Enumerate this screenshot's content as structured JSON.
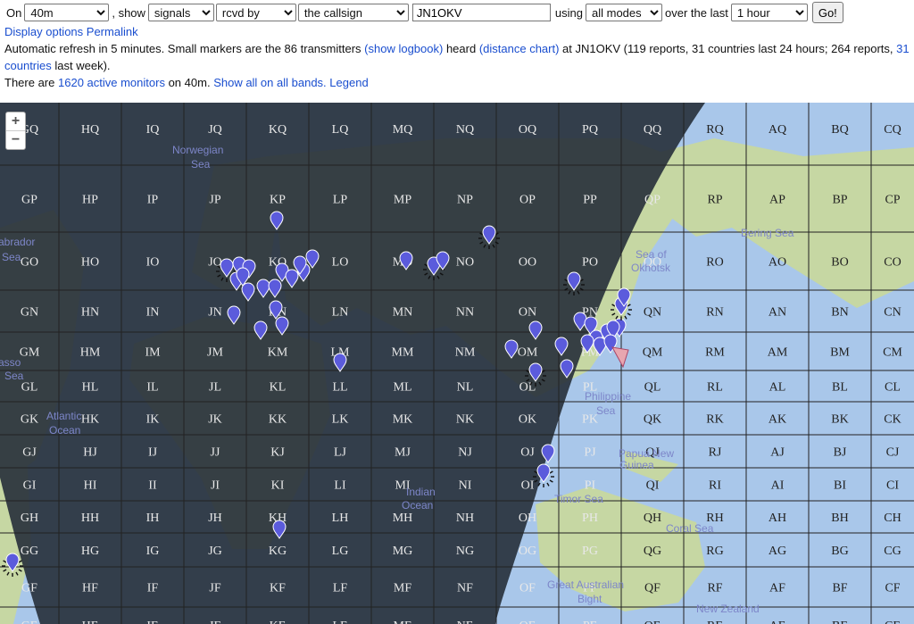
{
  "controls": {
    "on_label": "On",
    "band": "40m",
    "show_label": ", show",
    "show": "signals",
    "direction": "rcvd by",
    "target": "the callsign",
    "callsign": "JN1OKV",
    "using_label": "using",
    "mode": "all modes",
    "over_label": "over the last",
    "period": "1 hour",
    "go_label": "Go!"
  },
  "links": {
    "display_options": "Display options",
    "permalink": "Permalink",
    "show_logbook": "(show logbook)",
    "distance_chart": "(distance chart)",
    "countries_week_num": "31",
    "countries_word": "countries",
    "active_monitors": "1620 active monitors",
    "show_all": "Show all on all bands.",
    "legend": "Legend"
  },
  "info": {
    "line2a": "Automatic refresh in 5 minutes. Small markers are the 86 transmitters",
    "heard": "heard",
    "at_text": "at JN1OKV (119 reports, 31 countries last 24 hours; 264 reports,",
    "last_week": "last week).",
    "there_are": "There are",
    "on_band": "on 40m."
  },
  "map": {
    "zoom_in": "+",
    "zoom_out": "−",
    "col_field_letters": [
      "G",
      "H",
      "I",
      "J",
      "K",
      "L",
      "M",
      "N",
      "O",
      "P",
      "Q",
      "R",
      "A",
      "B",
      "C"
    ],
    "row_field_letters": [
      "Q",
      "P",
      "O",
      "N",
      "M",
      "L",
      "K",
      "J",
      "I",
      "H",
      "G",
      "F",
      "E"
    ],
    "place_labels": [
      "Norwegian",
      "Sea",
      "abrador",
      "Sea",
      "Bering Sea",
      "Sea of",
      "Okhotsk",
      "Philippine",
      "Sea",
      "Atlantic",
      "Ocean",
      "Indian",
      "Ocean",
      "Timor Sea",
      "Papua New",
      "Guinea",
      "Coral Sea",
      "Great Australian",
      "Bight",
      "New Zealand",
      "asso",
      "Sea"
    ],
    "colors": {
      "ocean": "#a9c7ea",
      "land": "#c6d7a3",
      "night": "#262f3a",
      "grid": "#222222",
      "marker": "#5b5bdc",
      "home": "#e8a6b0"
    }
  }
}
